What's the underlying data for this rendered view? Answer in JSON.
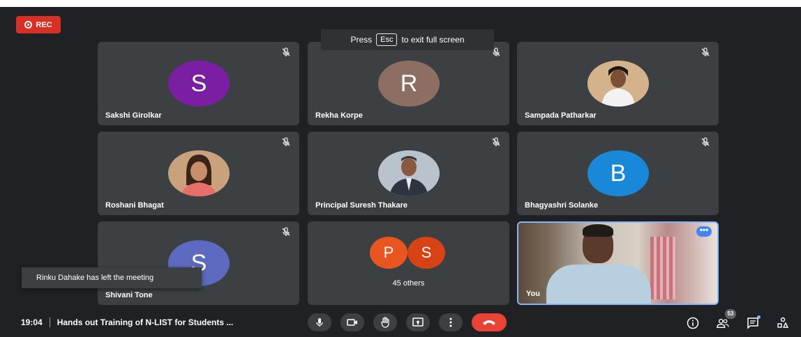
{
  "recording": {
    "label": "REC",
    "color": "#d93025"
  },
  "fullscreen_hint": {
    "prefix": "Press",
    "key": "Esc",
    "suffix": "to exit full screen"
  },
  "participants": [
    {
      "name": "Sakshi Girolkar",
      "initial": "S",
      "avatar_color": "#7b1fa2",
      "muted": true
    },
    {
      "name": "Rekha Korpe",
      "initial": "R",
      "avatar_color": "#8d6e63",
      "muted": true
    },
    {
      "name": "Sampada Patharkar",
      "initial": "",
      "avatar_type": "photo",
      "muted": true
    },
    {
      "name": "Roshani Bhagat",
      "initial": "",
      "avatar_type": "photo",
      "muted": true
    },
    {
      "name": "Principal Suresh Thakare",
      "initial": "",
      "avatar_type": "photo",
      "muted": true
    },
    {
      "name": "Bhagyashri Solanke",
      "initial": "B",
      "avatar_color": "#1a88d8",
      "muted": true
    },
    {
      "name": "Shivani Tone",
      "initial": "S",
      "avatar_color": "#5c6bc0",
      "muted": true
    }
  ],
  "others_tile": {
    "initials": [
      "P",
      "S"
    ],
    "colors": [
      "#e8551f",
      "#d84315"
    ],
    "label": "45 others"
  },
  "self_tile": {
    "label": "You",
    "accent": "#8ab4f8"
  },
  "notification": {
    "text": "Rinku Dahake has left the meeting"
  },
  "meeting": {
    "time": "19:04",
    "title": "Hands out Training of N-LIST for Students ..."
  },
  "controls": [
    "mic-icon",
    "camera-icon",
    "raise-hand-icon",
    "present-icon",
    "more-options-icon",
    "end-call-icon"
  ],
  "right_controls": {
    "people_count": "53",
    "icons": [
      "info-icon",
      "people-icon",
      "chat-icon",
      "activities-icon"
    ]
  },
  "colors": {
    "background": "#202124",
    "tile": "#3c4043",
    "end_call": "#ea4335"
  }
}
